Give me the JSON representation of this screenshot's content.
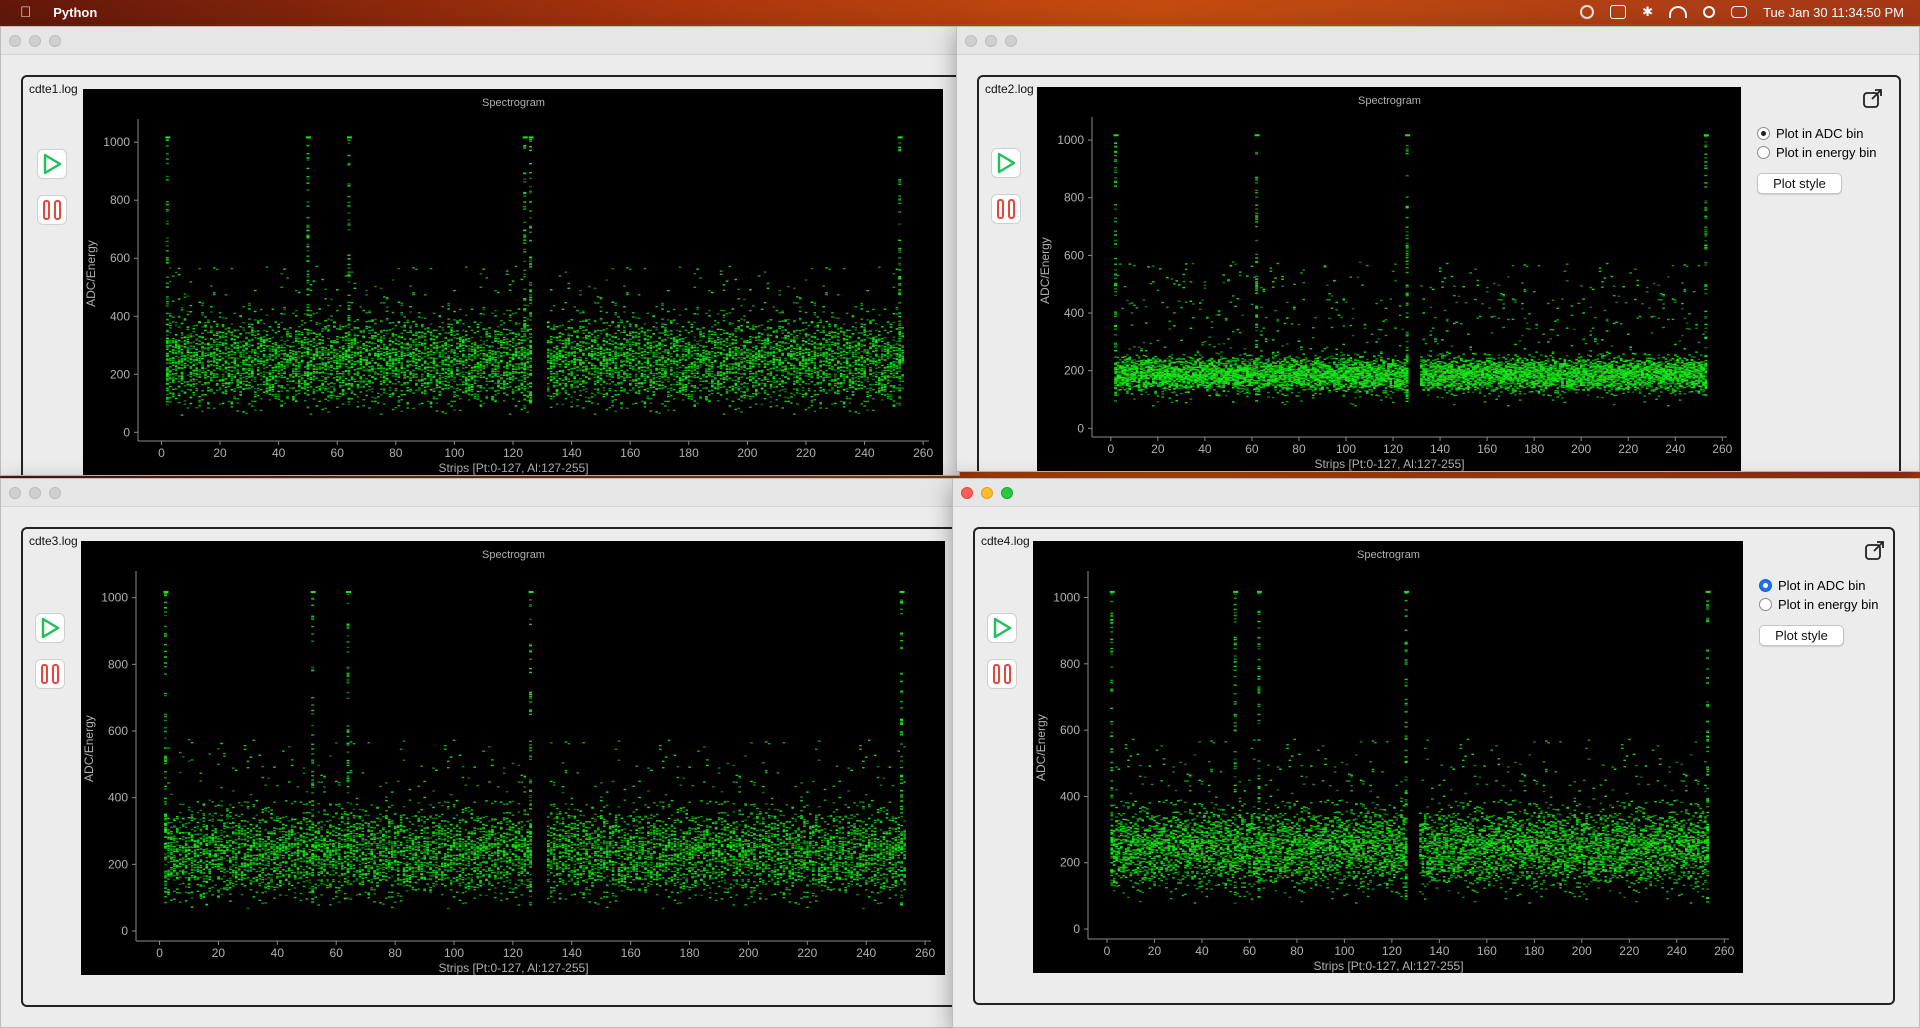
{
  "menubar": {
    "app_name": "Python",
    "datetime": "Tue Jan 30  11:34:50 PM"
  },
  "colors": {
    "spectrum_green": "#18e818",
    "axis_text": "#b0b0b0",
    "plot_bg": "#000000"
  },
  "panels": [
    {
      "label": "cdte1.log",
      "plot_title": "Spectrogram",
      "xlabel": "Strips [Pt:0-127, Al:127-255]",
      "ylabel": "ADC/Energy",
      "show_side": false
    },
    {
      "label": "cdte2.log",
      "plot_title": "Spectrogram",
      "xlabel": "Strips [Pt:0-127, Al:127-255]",
      "ylabel": "ADC/Energy",
      "show_side": true,
      "radio_adc": "Plot in ADC bin",
      "radio_energy": "Plot in energy bin",
      "plot_style": "Plot style"
    },
    {
      "label": "cdte3.log",
      "plot_title": "Spectrogram",
      "xlabel": "Strips [Pt:0-127, Al:127-255]",
      "ylabel": "ADC/Energy",
      "show_side": false
    },
    {
      "label": "cdte4.log",
      "plot_title": "Spectrogram",
      "xlabel": "Strips [Pt:0-127, Al:127-255]",
      "ylabel": "ADC/Energy",
      "show_side": true,
      "radio_adc": "Plot in ADC bin",
      "radio_energy": "Plot in energy bin",
      "plot_style": "Plot style"
    }
  ],
  "chart_data": [
    {
      "type": "heatmap",
      "title": "Spectrogram",
      "xlabel": "Strips [Pt:0-127, Al:127-255]",
      "ylabel": "ADC/Energy",
      "xlim": [
        -8,
        262
      ],
      "ylim": [
        -30,
        1080
      ],
      "xticks": [
        "0",
        "20",
        "40",
        "60",
        "80",
        "100",
        "120",
        "140",
        "160",
        "180",
        "200",
        "220",
        "240",
        "260"
      ],
      "yticks": [
        "0",
        "200",
        "400",
        "600",
        "800",
        "1000"
      ],
      "band_center": 250,
      "band_spread": 110,
      "dense_strips": [
        2,
        50,
        64,
        124,
        126,
        252
      ]
    },
    {
      "type": "heatmap",
      "title": "Spectrogram",
      "xlabel": "Strips [Pt:0-127, Al:127-255]",
      "ylabel": "ADC/Energy",
      "xlim": [
        -8,
        262
      ],
      "ylim": [
        -30,
        1080
      ],
      "xticks": [
        "0",
        "20",
        "40",
        "60",
        "80",
        "100",
        "120",
        "140",
        "160",
        "180",
        "200",
        "220",
        "240",
        "260"
      ],
      "yticks": [
        "0",
        "200",
        "400",
        "600",
        "800",
        "1000"
      ],
      "band_center": 190,
      "band_spread": 45,
      "dense_strips": [
        2,
        62,
        126,
        253
      ]
    },
    {
      "type": "heatmap",
      "title": "Spectrogram",
      "xlabel": "Strips [Pt:0-127, Al:127-255]",
      "ylabel": "ADC/Energy",
      "xlim": [
        -8,
        262
      ],
      "ylim": [
        -30,
        1080
      ],
      "xticks": [
        "0",
        "20",
        "40",
        "60",
        "80",
        "100",
        "120",
        "140",
        "160",
        "180",
        "200",
        "220",
        "240",
        "260"
      ],
      "yticks": [
        "0",
        "200",
        "400",
        "600",
        "800",
        "1000"
      ],
      "band_center": 240,
      "band_spread": 95,
      "dense_strips": [
        2,
        52,
        64,
        126,
        252
      ]
    },
    {
      "type": "heatmap",
      "title": "Spectrogram",
      "xlabel": "Strips [Pt:0-127, Al:127-255]",
      "ylabel": "ADC/Energy",
      "xlim": [
        -8,
        262
      ],
      "ylim": [
        -30,
        1080
      ],
      "xticks": [
        "0",
        "20",
        "40",
        "60",
        "80",
        "100",
        "120",
        "140",
        "160",
        "180",
        "200",
        "220",
        "240",
        "260"
      ],
      "yticks": [
        "0",
        "200",
        "400",
        "600",
        "800",
        "1000"
      ],
      "band_center": 250,
      "band_spread": 85,
      "dense_strips": [
        2,
        54,
        64,
        126,
        253
      ]
    }
  ]
}
